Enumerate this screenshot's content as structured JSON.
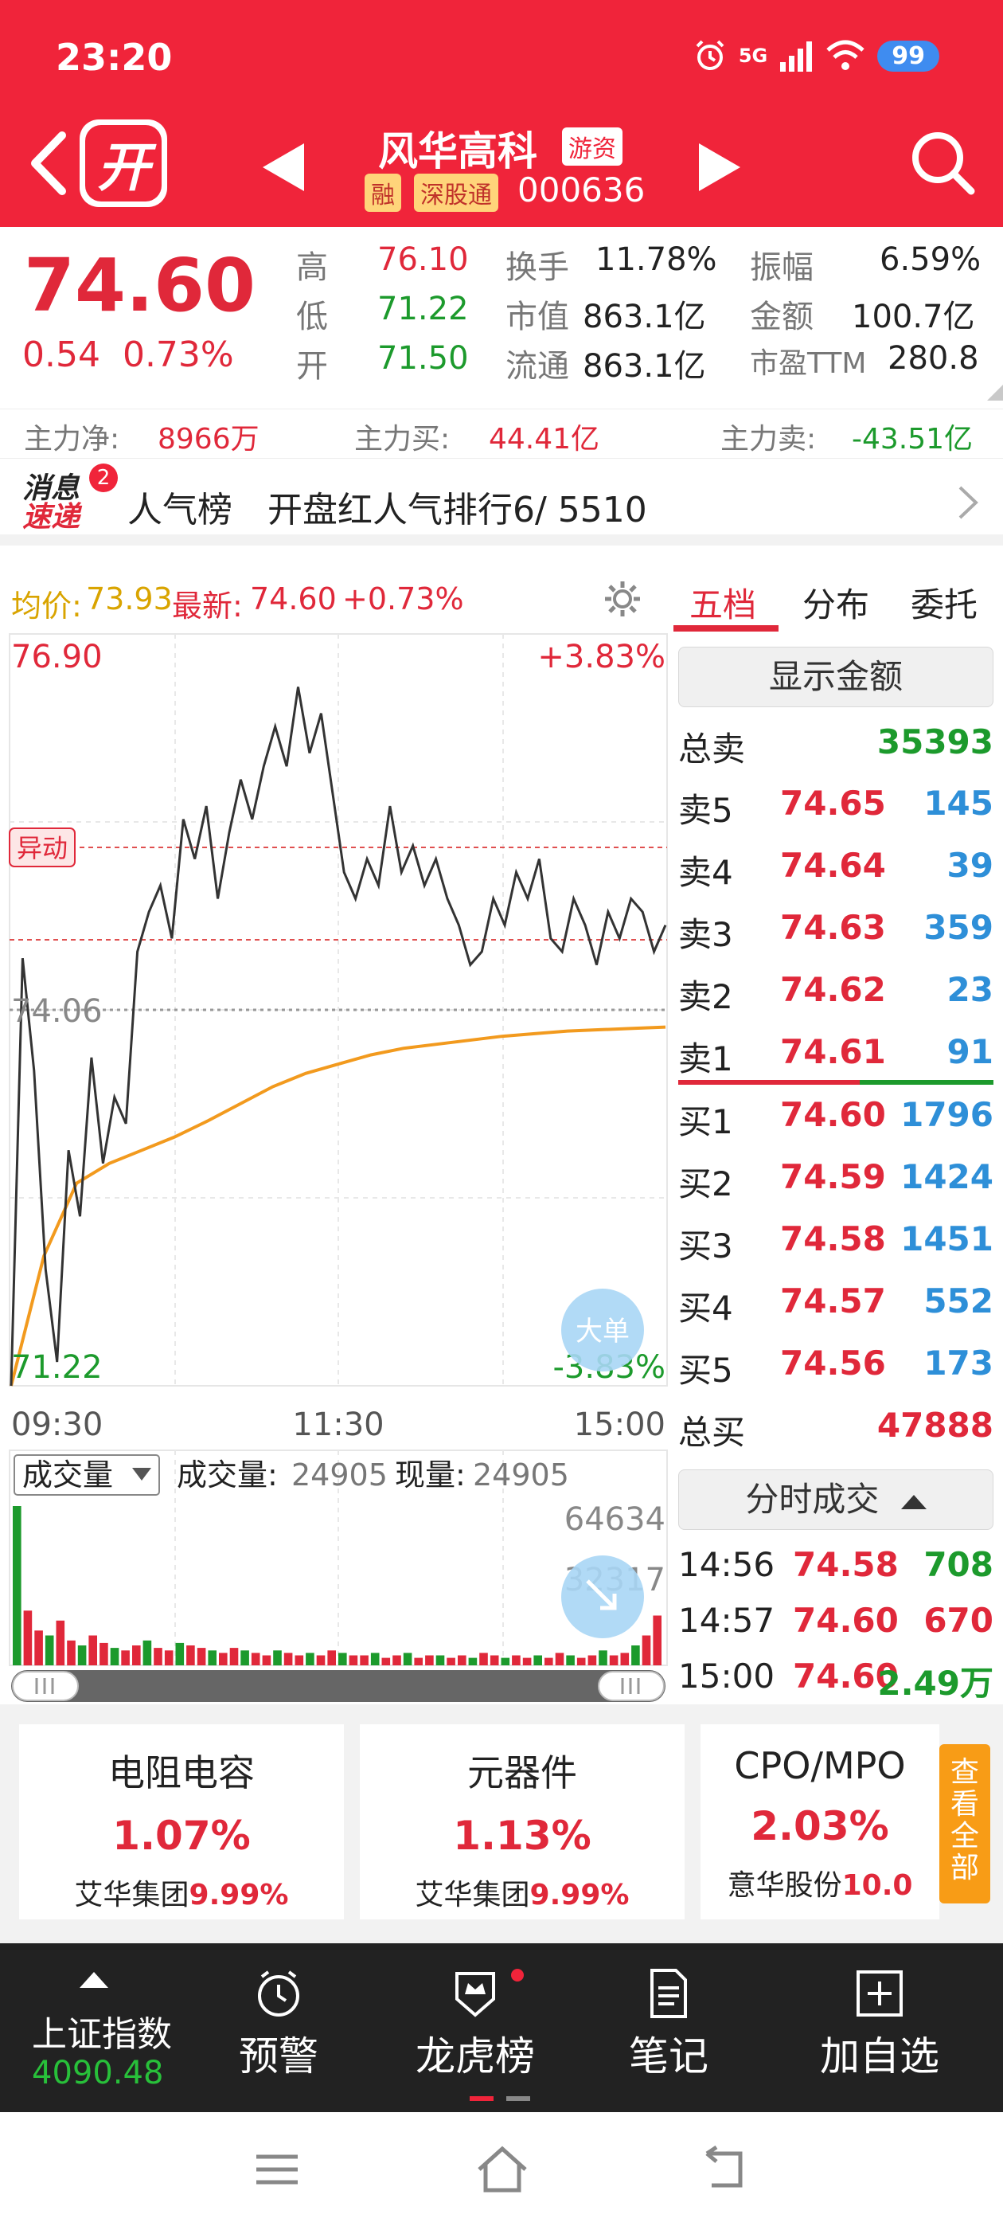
{
  "status": {
    "time": "23:20",
    "network": "5G",
    "battery": "99"
  },
  "header": {
    "logo_char": "开",
    "name": "风华高科",
    "tag_youzi": "游资",
    "tag_rong": "融",
    "tag_sgt": "深股通",
    "code": "000636"
  },
  "quote": {
    "price": "74.60",
    "change": "0.54",
    "change_pct": "0.73%",
    "high_label": "高",
    "high": "76.10",
    "low_label": "低",
    "low": "71.22",
    "open_label": "开",
    "open": "71.50",
    "turnover_label": "换手",
    "turnover": "11.78%",
    "mktcap_label": "市值",
    "mktcap": "863.1亿",
    "float_label": "流通",
    "float": "863.1亿",
    "amplitude_label": "振幅",
    "amplitude": "6.59%",
    "amount_label": "金额",
    "amount": "100.7亿",
    "pe_label": "市盈TTM",
    "pe": "280.8"
  },
  "capflow": {
    "net_label": "主力净:",
    "net": "8966万",
    "buy_label": "主力买:",
    "buy": "44.41亿",
    "sell_label": "主力卖:",
    "sell": "-43.51亿"
  },
  "news": {
    "logo_line1": "消息",
    "logo_line2": "速递",
    "badge": "2",
    "title": "人气榜",
    "text": "开盘红人气排行6/ 5510"
  },
  "chart_head": {
    "avg_label": "均价:",
    "avg": "73.93",
    "last_label": "最新:",
    "last": "74.60",
    "last_pct": "+0.73%"
  },
  "chart_data": {
    "type": "line",
    "y_top": "76.90",
    "y_mid": "74.06",
    "y_bottom": "71.22",
    "pct_top": "+3.83%",
    "pct_bottom": "-3.83%",
    "ylim": [
      71.22,
      76.9
    ],
    "mark_label": "异动",
    "big_order_label": "大单",
    "x_ticks": [
      "09:30",
      "11:30",
      "15:00"
    ],
    "price_series": [
      71.22,
      74.45,
      73.6,
      72.1,
      71.4,
      73.0,
      72.5,
      73.7,
      72.9,
      73.4,
      73.2,
      74.5,
      74.8,
      75.0,
      74.6,
      75.5,
      75.2,
      75.6,
      74.9,
      75.4,
      75.8,
      75.5,
      75.9,
      76.2,
      75.9,
      76.5,
      76.0,
      76.3,
      75.7,
      75.1,
      74.9,
      75.2,
      75.0,
      75.6,
      75.1,
      75.3,
      75.0,
      75.2,
      74.9,
      74.7,
      74.4,
      74.5,
      74.9,
      74.7,
      75.1,
      74.9,
      75.2,
      74.6,
      74.5,
      74.9,
      74.7,
      74.4,
      74.8,
      74.6,
      74.9,
      74.8,
      74.5,
      74.7
    ],
    "avg_series": [
      71.22,
      72.2,
      72.75,
      72.9,
      73.0,
      73.1,
      73.22,
      73.35,
      73.48,
      73.58,
      73.65,
      73.72,
      73.77,
      73.8,
      73.83,
      73.86,
      73.88,
      73.9,
      73.91,
      73.92,
      73.93
    ]
  },
  "volume": {
    "dropdown": "成交量",
    "vol_label": "成交量:",
    "vol": "24905",
    "cur_label": "现量:",
    "cur": "24905",
    "y_max": "64634",
    "y_mid": "32317",
    "bars": [
      64,
      22,
      14,
      12,
      18,
      10,
      8,
      12,
      9,
      7,
      6,
      8,
      10,
      7,
      6,
      9,
      8,
      7,
      6,
      5,
      7,
      6,
      5,
      4,
      6,
      5,
      4,
      5,
      4,
      6,
      5,
      4,
      4,
      5,
      3,
      4,
      5,
      3,
      4,
      4,
      3,
      4,
      3,
      5,
      4,
      3,
      4,
      3,
      4,
      3,
      5,
      4,
      3,
      4,
      6,
      4,
      5,
      8,
      12,
      20
    ]
  },
  "orderbook": {
    "tabs": [
      "五档",
      "分布",
      "委托"
    ],
    "show_amount": "显示金额",
    "total_sell_label": "总卖",
    "total_sell": "35393",
    "asks": [
      {
        "label": "卖5",
        "price": "74.65",
        "vol": "145"
      },
      {
        "label": "卖4",
        "price": "74.64",
        "vol": "39"
      },
      {
        "label": "卖3",
        "price": "74.63",
        "vol": "359"
      },
      {
        "label": "卖2",
        "price": "74.62",
        "vol": "23"
      },
      {
        "label": "卖1",
        "price": "74.61",
        "vol": "91"
      }
    ],
    "bids": [
      {
        "label": "买1",
        "price": "74.60",
        "vol": "1796"
      },
      {
        "label": "买2",
        "price": "74.59",
        "vol": "1424"
      },
      {
        "label": "买3",
        "price": "74.58",
        "vol": "1451"
      },
      {
        "label": "买4",
        "price": "74.57",
        "vol": "552"
      },
      {
        "label": "买5",
        "price": "74.56",
        "vol": "173"
      }
    ],
    "total_buy_label": "总买",
    "total_buy": "47888",
    "ticks_button": "分时成交",
    "ticks": [
      {
        "time": "14:56",
        "price": "74.58",
        "vol": "708"
      },
      {
        "time": "14:57",
        "price": "74.60",
        "vol": "670"
      },
      {
        "time": "15:00",
        "price": "74.60",
        "vol": "2.49万"
      }
    ]
  },
  "sectors": [
    {
      "name": "电阻电容",
      "change": "1.07%",
      "leader": "艾华集团",
      "leader_pct": "9.99%"
    },
    {
      "name": "元器件",
      "change": "1.13%",
      "leader": "艾华集团",
      "leader_pct": "9.99%"
    },
    {
      "name": "CPO/MPO",
      "change": "2.03%",
      "leader": "意华股份",
      "leader_pct": "10.0"
    }
  ],
  "see_all": "查看全部",
  "bottombar": {
    "index_name": "上证指数",
    "index_value": "4090.48",
    "alert": "预警",
    "dragon": "龙虎榜",
    "notes": "笔记",
    "add": "加自选"
  }
}
